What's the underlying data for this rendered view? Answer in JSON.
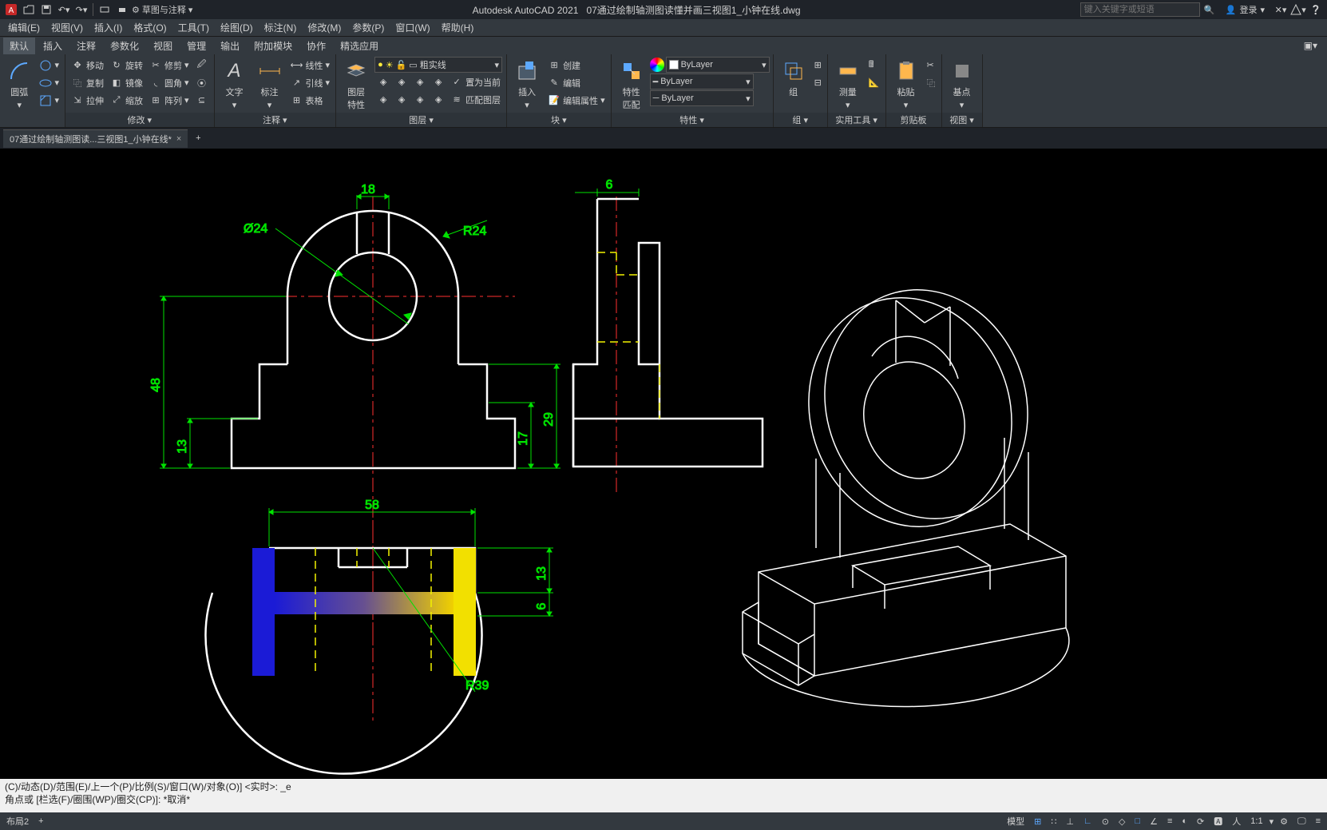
{
  "app_title": "Autodesk AutoCAD 2021",
  "filename": "07通过绘制轴测图读懂并画三视图1_小钟在线.dwg",
  "search_placeholder": "键入关键字或短语",
  "login": "登录",
  "workspace": "草图与注释",
  "menu": {
    "file": "编辑(E)",
    "view": "视图(V)",
    "insert": "插入(I)",
    "format": "格式(O)",
    "tools": "工具(T)",
    "draw": "绘图(D)",
    "dim": "标注(N)",
    "modify": "修改(M)",
    "param": "参数(P)",
    "window": "窗口(W)",
    "help": "帮助(H)"
  },
  "rtabs": {
    "default": "默认",
    "insert": "插入",
    "annotate": "注释",
    "param": "参数化",
    "view": "视图",
    "manage": "管理",
    "output": "输出",
    "addon": "附加模块",
    "collab": "协作",
    "featured": "精选应用"
  },
  "ribbon": {
    "draw": {
      "arc": "圆弧"
    },
    "modify": {
      "label": "修改 ▾",
      "move": "移动",
      "rotate": "旋转",
      "trim": "修剪",
      "copy": "复制",
      "mirror": "镜像",
      "fillet": "圆角",
      "stretch": "拉伸",
      "scale": "缩放",
      "array": "阵列"
    },
    "annot": {
      "label": "注释 ▾",
      "text": "文字",
      "dim": "标注",
      "linear": "线性",
      "leader": "引线",
      "table": "表格"
    },
    "layer": {
      "label": "图层 ▾",
      "props": "图层\n特性",
      "current": "粗实线",
      "setcur": "置为当前",
      "match": "匹配图层"
    },
    "block": {
      "label": "块 ▾",
      "insert": "插入",
      "create": "创建",
      "edit": "编辑",
      "attr": "编辑属性"
    },
    "prop": {
      "label": "特性 ▾",
      "match": "特性\n匹配",
      "bylayer": "ByLayer"
    },
    "group": {
      "label": "组 ▾",
      "group": "组"
    },
    "util": {
      "label": "实用工具 ▾",
      "measure": "测量"
    },
    "clip": {
      "label": "剪贴板",
      "paste": "粘贴"
    },
    "vw": {
      "label": "视图 ▾",
      "base": "基点"
    }
  },
  "tab_short": "07通过绘制轴测图读...三视图1_小钟在线*",
  "cmd": {
    "l1": "(C)/动态(D)/范围(E)/上一个(P)/比例(S)/窗口(W)/对象(O)] <实时>: _e",
    "l2": "角点或 [栏选(F)/圈围(WP)/圈交(CP)]: *取消*"
  },
  "status": {
    "layout": "布局2",
    "model": "模型",
    "scale": "1:1"
  },
  "dims": {
    "d18": "18",
    "d6": "6",
    "r24": "R24",
    "d24": "Ø24",
    "d48": "48",
    "d13": "13",
    "d17": "17",
    "d29": "29",
    "d58": "58",
    "d13b": "13",
    "d6b": "6",
    "r39": "R39"
  }
}
